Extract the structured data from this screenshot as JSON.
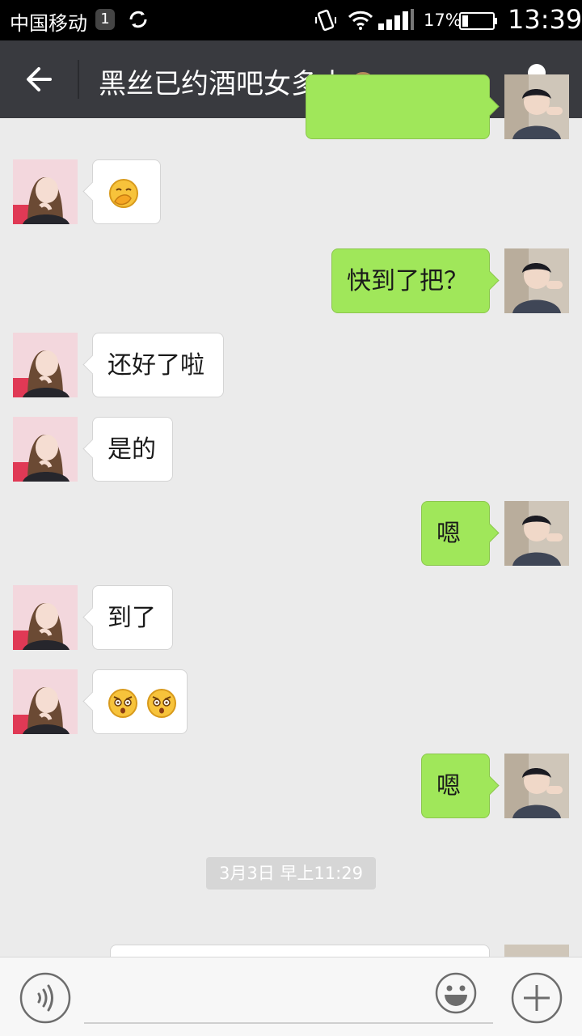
{
  "status_bar": {
    "carrier": "中国移动",
    "notification_count": "1",
    "battery_percent": "17%",
    "time": "13:39"
  },
  "header": {
    "title": "黑丝已约酒吧女多水🙈"
  },
  "messages": [
    {
      "direction": "in",
      "text": ""
    },
    {
      "direction": "out",
      "text": "快到了把？"
    },
    {
      "direction": "in",
      "text": "还好了啦"
    },
    {
      "direction": "in",
      "text": "是的"
    },
    {
      "direction": "out",
      "text": "嗯"
    },
    {
      "direction": "in",
      "text": "到了"
    },
    {
      "direction": "in",
      "text": ""
    },
    {
      "direction": "out",
      "text": "嗯"
    }
  ],
  "emoji": {
    "m0": "covering-mouth-face",
    "m6": "surprised-face-x2"
  },
  "timestamp": "3月3日 早上11:29",
  "input": {
    "value": "",
    "placeholder": ""
  },
  "colors": {
    "title_bar": "#393a3f",
    "outgoing_bubble": "#a0e75a",
    "incoming_bubble": "#ffffff",
    "chat_background": "#ebebeb"
  }
}
